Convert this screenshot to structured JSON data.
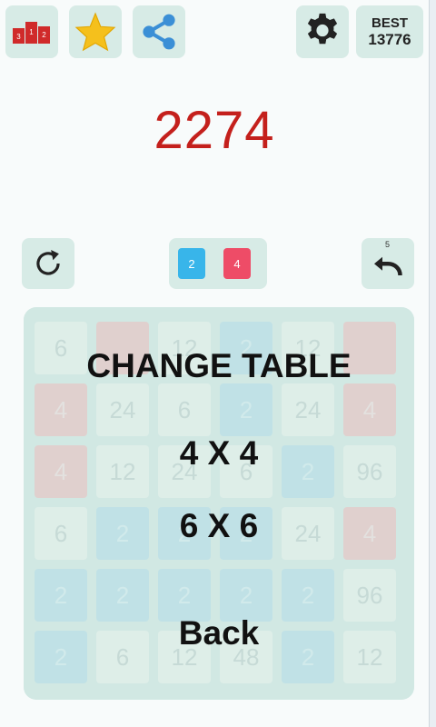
{
  "header": {
    "best_label": "BEST",
    "best_value": "13776"
  },
  "score": "2274",
  "preview_tiles": [
    "2",
    "4"
  ],
  "undo_count": "5",
  "menu": {
    "title": "CHANGE TABLE",
    "options": [
      "4 X 4",
      "6 X 6"
    ],
    "back_label": "Back"
  },
  "board": {
    "tiles": [
      [
        "6",
        "",
        "12",
        "2",
        "12",
        ""
      ],
      [
        "4",
        "24",
        "6",
        "2",
        "24",
        "4"
      ],
      [
        "4",
        "12",
        "24",
        "6",
        "2",
        "96"
      ],
      [
        "6",
        "2",
        "2",
        "2",
        "24",
        "4"
      ],
      [
        "2",
        "2",
        "2",
        "2",
        "2",
        "96"
      ],
      [
        "2",
        "6",
        "12",
        "48",
        "2",
        "12"
      ]
    ],
    "tile_colors": [
      [
        "pale",
        "red",
        "pale",
        "blue",
        "pale",
        "red"
      ],
      [
        "red",
        "pale",
        "pale",
        "blue",
        "pale",
        "red"
      ],
      [
        "red",
        "pale",
        "pale",
        "pale",
        "blue",
        "pale"
      ],
      [
        "pale",
        "blue",
        "blue",
        "blue",
        "pale",
        "red"
      ],
      [
        "blue",
        "blue",
        "blue",
        "blue",
        "blue",
        "pale"
      ],
      [
        "blue",
        "pale",
        "pale",
        "pale",
        "blue",
        "pale"
      ]
    ]
  },
  "colors": {
    "score": "#c4201c",
    "tile_red": "#f0b1b2",
    "tile_blue": "#a9d8e6",
    "button_bg": "#d7ebe6",
    "board_bg": "#cfe6e1"
  },
  "icons": [
    "leaderboard-icon",
    "star-icon",
    "share-icon",
    "gear-icon",
    "restart-icon",
    "undo-icon"
  ]
}
